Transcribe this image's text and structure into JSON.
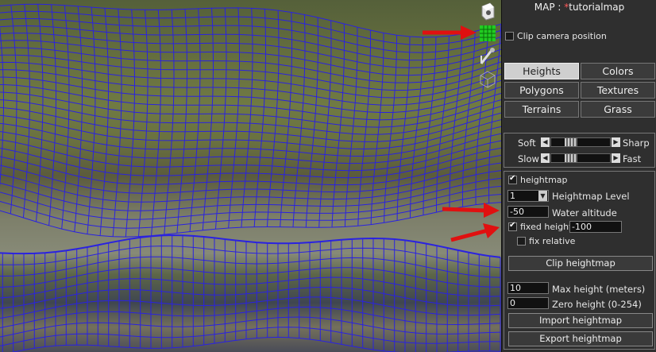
{
  "panel": {
    "title_prefix": "MAP : ",
    "modified_marker": "*",
    "map_name": "tutorialmap",
    "clip_camera_label": "Clip camera position",
    "clip_camera_checked": false
  },
  "modes": [
    {
      "label": "Heights",
      "active": true
    },
    {
      "label": "Colors",
      "active": false
    },
    {
      "label": "Polygons",
      "active": false
    },
    {
      "label": "Textures",
      "active": false
    },
    {
      "label": "Terrains",
      "active": false
    },
    {
      "label": "Grass",
      "active": false
    }
  ],
  "brush": {
    "soft_label": "Soft",
    "sharp_label": "Sharp",
    "slow_label": "Slow",
    "fast_label": "Fast",
    "hardness_level": 0.3,
    "speed_level": 0.3
  },
  "heightmap": {
    "enabled_label": "heightmap",
    "enabled_checked": true,
    "level_value": "1",
    "level_label": "Heightmap Level",
    "water_value": "-50",
    "water_label": "Water altitude",
    "fixed_label": "fixed height",
    "fixed_checked": true,
    "fixed_value": "-100",
    "relative_label": "fix relative",
    "relative_checked": false,
    "clip_button": "Clip heightmap",
    "max_value": "10",
    "max_label": "Max height (meters)",
    "zero_value": "0",
    "zero_label": "Zero height (0-254)",
    "import_button": "Import heightmap",
    "export_button": "Export heightmap"
  },
  "toolbar_icons": [
    "camera-icon",
    "grid-icon",
    "brush-icon",
    "cube-icon"
  ],
  "colors": {
    "mesh": "#2a22e0",
    "annotation_arrow": "#e01010",
    "grid_active": "#22cc22",
    "modified_marker": "#ff5a5a"
  }
}
